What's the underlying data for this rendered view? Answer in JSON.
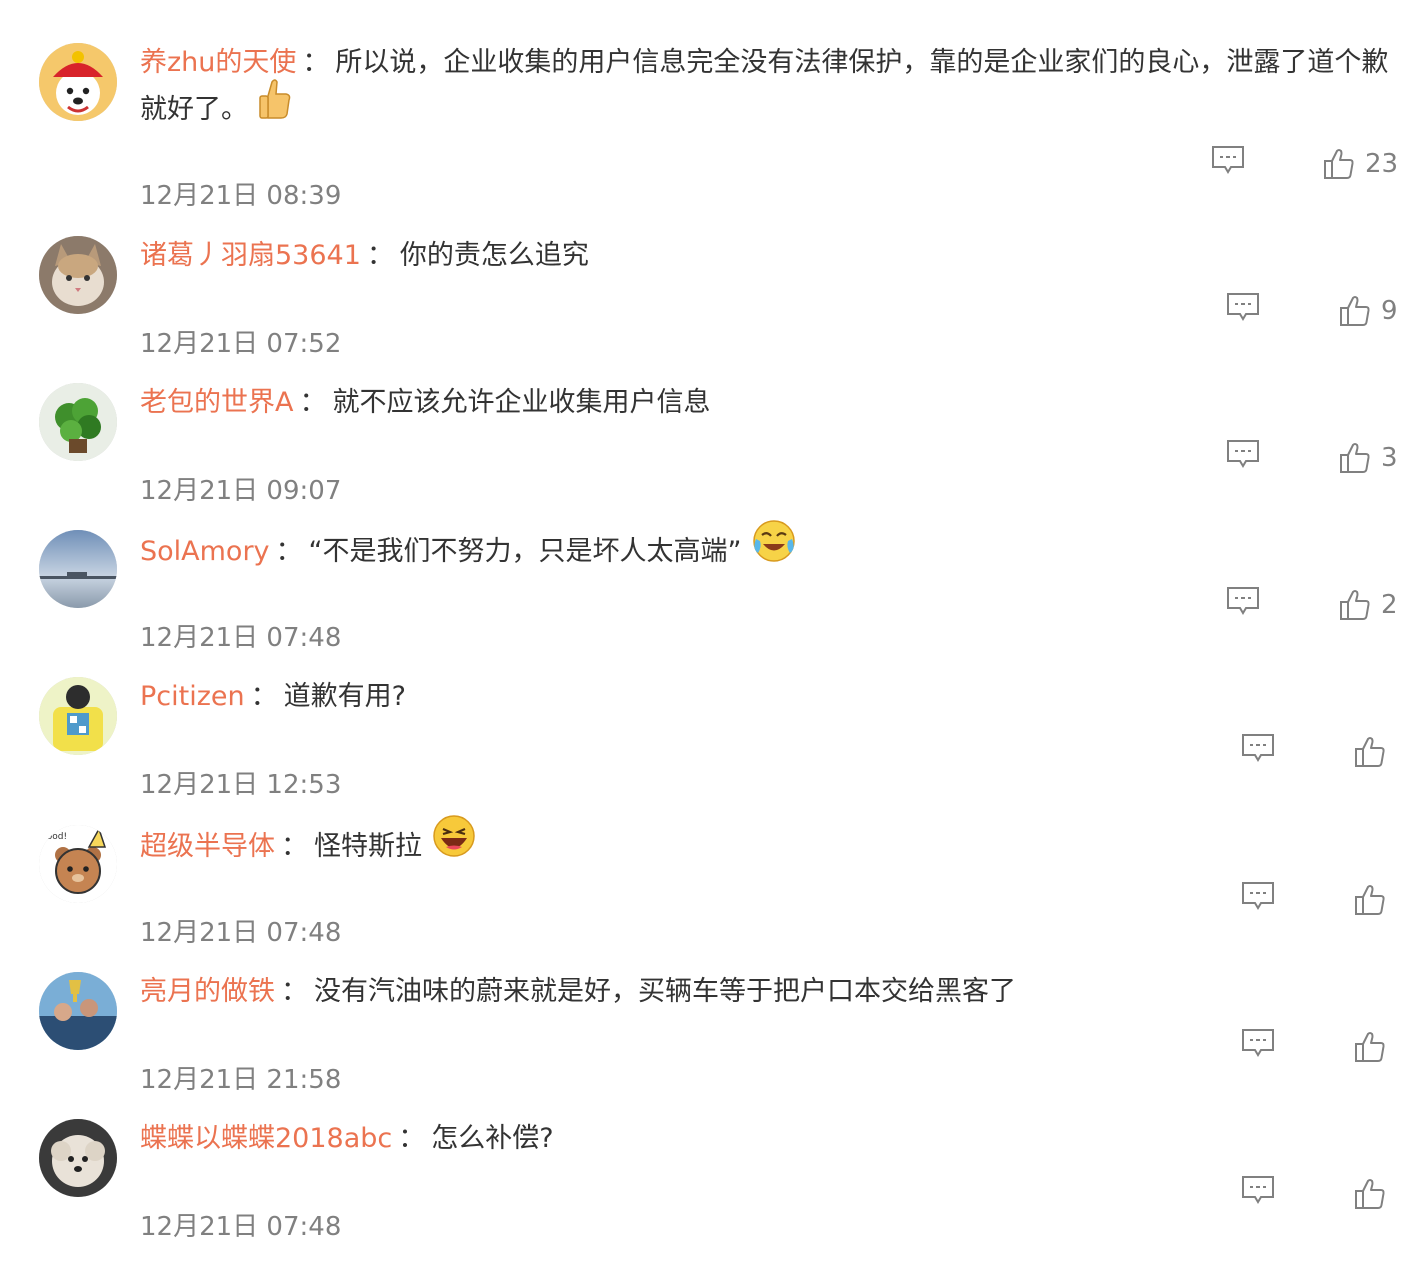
{
  "comments": [
    {
      "username": "养zhu的天使",
      "colon": "：",
      "text": "所以说，企业收集的用户信息完全没有法律保护，靠的是企业家们的良心，泄露了道个歉就好了。",
      "emoji": "thumbs-up-emoji",
      "time": "12月21日 08:39",
      "likes": "23",
      "reply_icon": "reply-icon",
      "like_icon": "thumbs-up-icon"
    },
    {
      "username": "诸葛丿羽扇53641",
      "colon": "：",
      "text": "你的责怎么追究",
      "time": "12月21日 07:52",
      "likes": "9"
    },
    {
      "username": "老包的世界A",
      "colon": "：",
      "text": "就不应该允许企业收集用户信息",
      "time": "12月21日 09:07",
      "likes": "3"
    },
    {
      "username": "SolAmory",
      "colon": "：",
      "text": "“不是我们不努力，只是坏人太高端”",
      "emoji": "laugh-cry-emoji",
      "time": "12月21日 07:48",
      "likes": "2"
    },
    {
      "username": "Pcitizen",
      "colon": "：",
      "text": "道歉有用?",
      "time": "12月21日 12:53",
      "likes": ""
    },
    {
      "username": "超级半导体",
      "colon": "：",
      "text": "怪特斯拉",
      "emoji": "laughing-emoji",
      "time": "12月21日 07:48",
      "likes": ""
    },
    {
      "username": "亮月的做铁",
      "colon": "：",
      "text": "没有汽油味的蔚来就是好，买辆车等于把户口本交给黑客了",
      "time": "12月21日 21:58",
      "likes": ""
    },
    {
      "username": "蝶蝶以蝶蝶2018abc",
      "colon": "：",
      "text": "怎么补偿?",
      "time": "12月21日 07:48",
      "likes": ""
    }
  ],
  "colors": {
    "username": "#eb7350",
    "text": "#333333",
    "meta": "#808080",
    "icon": "#808080"
  }
}
